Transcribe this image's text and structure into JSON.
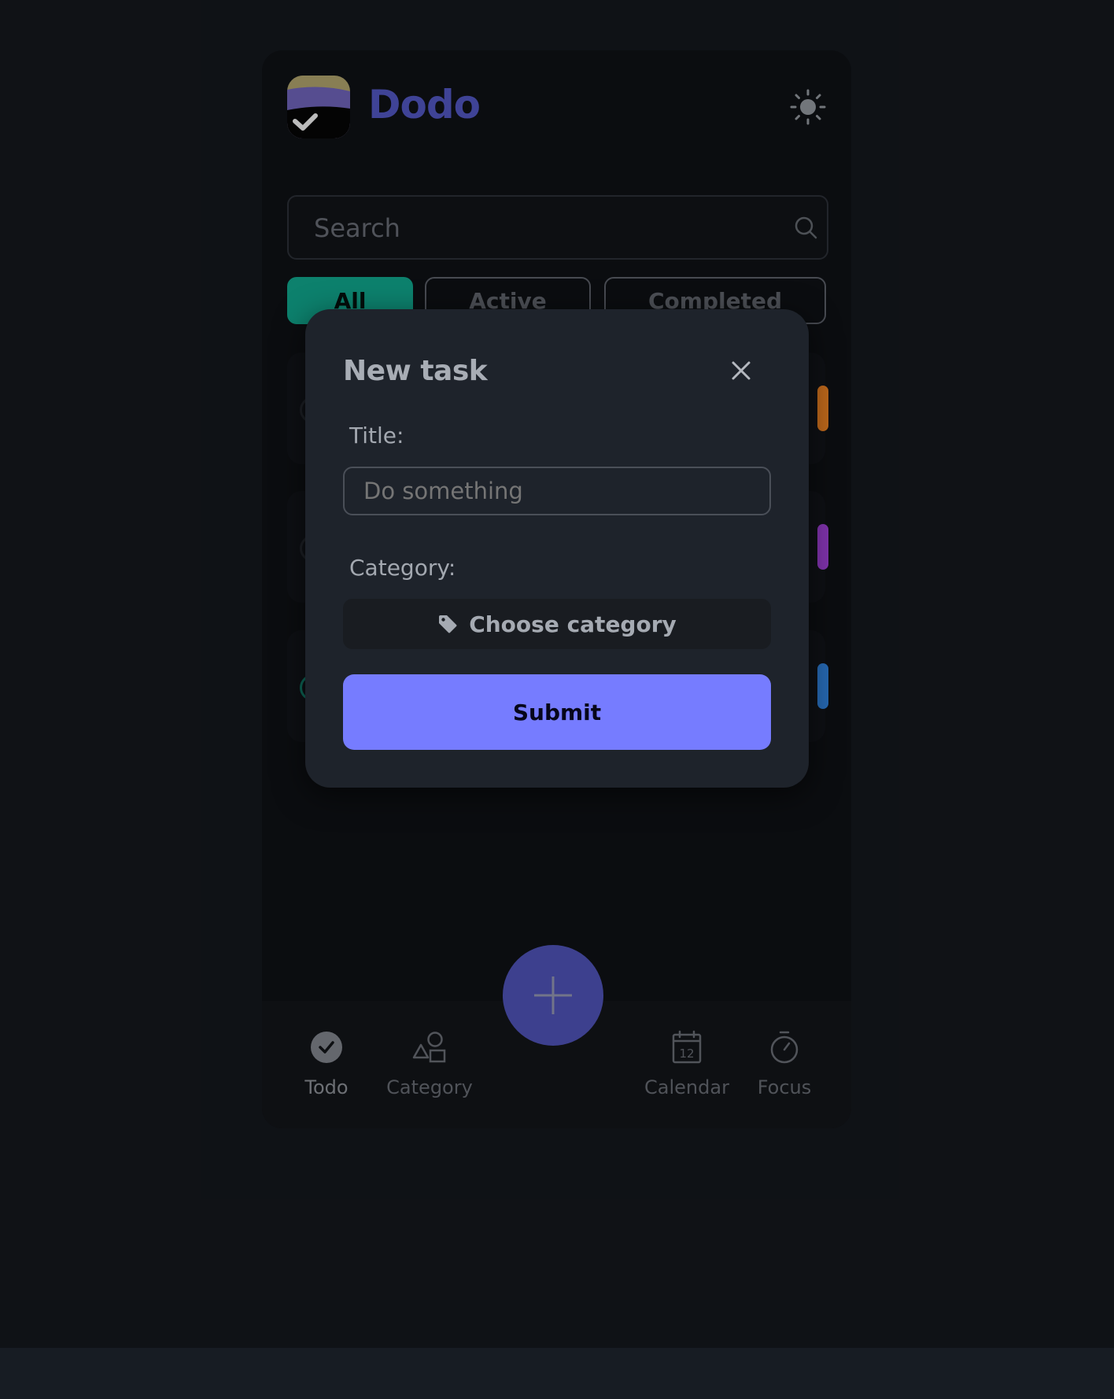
{
  "app": {
    "name": "Dodo"
  },
  "search": {
    "placeholder": "Search"
  },
  "filters": {
    "tabs": [
      {
        "label": "All",
        "selected": true
      },
      {
        "label": "Active",
        "selected": false
      },
      {
        "label": "Completed",
        "selected": false
      }
    ]
  },
  "tasks": {
    "accent_colors": [
      "#e67e22",
      "#9b3fd1",
      "#2f7fd8"
    ]
  },
  "modal": {
    "title": "New task",
    "title_label": "Title:",
    "title_placeholder": "Do something",
    "category_label": "Category:",
    "choose_category": "Choose category",
    "submit": "Submit"
  },
  "nav": {
    "items": [
      {
        "label": "Todo",
        "icon": "check-circle-icon",
        "active": true
      },
      {
        "label": "Category",
        "icon": "shapes-icon",
        "active": false
      },
      {
        "label": "Calendar",
        "icon": "calendar-icon",
        "active": false
      },
      {
        "label": "Focus",
        "icon": "stopwatch-icon",
        "active": false
      }
    ],
    "calendar_day": "12"
  },
  "colors": {
    "brand": "#4d52b8",
    "accent_primary": "#767cff",
    "tab_selected": "#119e86",
    "fab": "#4b4fae"
  }
}
